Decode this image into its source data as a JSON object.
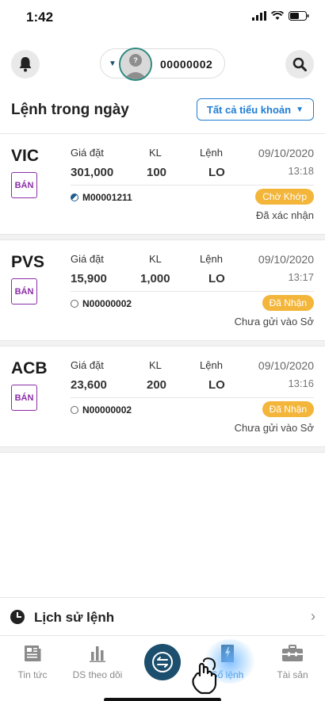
{
  "status_bar": {
    "time": "1:42"
  },
  "header": {
    "account_id": "00000002"
  },
  "section": {
    "title": "Lệnh trong ngày",
    "filter_label": "Tất cả tiểu khoản"
  },
  "labels": {
    "price": "Giá đặt",
    "qty": "KL",
    "type": "Lệnh"
  },
  "orders": [
    {
      "symbol": "VIC",
      "side": "BÁN",
      "price": "301,000",
      "qty": "100",
      "type": "LO",
      "date": "09/10/2020",
      "time": "13:18",
      "account": "M00001211",
      "status": "Chờ Khớp",
      "substatus": "Đã xác nhận"
    },
    {
      "symbol": "PVS",
      "side": "BÁN",
      "price": "15,900",
      "qty": "1,000",
      "type": "LO",
      "date": "09/10/2020",
      "time": "13:17",
      "account": "N00000002",
      "status": "Đã Nhận",
      "substatus": "Chưa gửi vào Sở"
    },
    {
      "symbol": "ACB",
      "side": "BÁN",
      "price": "23,600",
      "qty": "200",
      "type": "LO",
      "date": "09/10/2020",
      "time": "13:16",
      "account": "N00000002",
      "status": "Đã Nhận",
      "substatus": "Chưa gửi vào Sở"
    }
  ],
  "history": {
    "label": "Lịch sử lệnh"
  },
  "nav": {
    "news": "Tin tức",
    "watchlist": "DS theo dõi",
    "orders": "Sổ lệnh",
    "assets": "Tài sản"
  },
  "colors": {
    "accent": "#1f7dd3",
    "sell": "#8a2da8",
    "status": "#f3b53a",
    "nav_dark": "#1b4f6d"
  }
}
